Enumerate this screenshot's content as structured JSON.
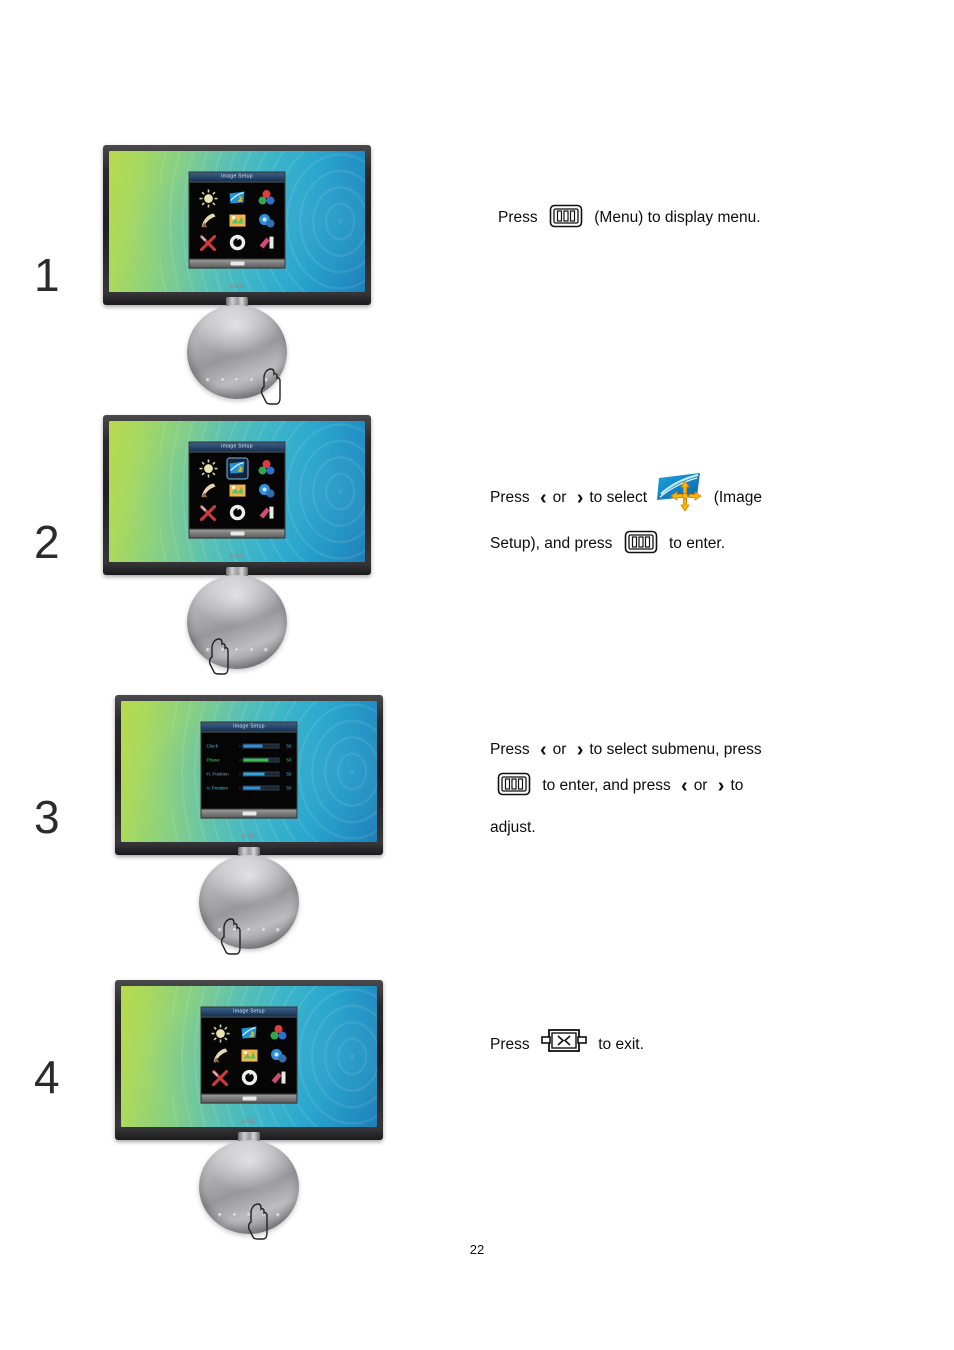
{
  "page": {
    "number": "22"
  },
  "icons": {
    "menu_key": "menu-key-icon",
    "exit_key": "exit-key-icon",
    "left_chevron": "‹",
    "right_chevron": "›",
    "image_setup": "image-setup-icon"
  },
  "steps": [
    {
      "number": "1",
      "monitor": {
        "brand": "AOC",
        "osd_title": "Image Setup",
        "osd_mode": "grid",
        "selected_index": -1
      },
      "text": {
        "lines": [
          [
            {
              "type": "text",
              "value": "Press"
            },
            {
              "type": "icon",
              "value": "menu-key-icon"
            },
            {
              "type": "text",
              "value": "(Menu) to display menu."
            }
          ]
        ]
      }
    },
    {
      "number": "2",
      "monitor": {
        "brand": "AOC",
        "osd_title": "Image Setup",
        "osd_mode": "grid",
        "selected_index": 1
      },
      "text": {
        "lines": [
          [
            {
              "type": "text",
              "value": "Press"
            },
            {
              "type": "chev",
              "value": "‹"
            },
            {
              "type": "text",
              "value": "or"
            },
            {
              "type": "chev",
              "value": "›"
            },
            {
              "type": "text",
              "value": "to select"
            },
            {
              "type": "icon",
              "value": "image-setup-icon"
            },
            {
              "type": "text",
              "value": "(Image"
            }
          ],
          [
            {
              "type": "text",
              "value": "Setup), and press"
            },
            {
              "type": "icon",
              "value": "menu-key-icon"
            },
            {
              "type": "text",
              "value": "to enter."
            }
          ]
        ]
      }
    },
    {
      "number": "3",
      "monitor": {
        "brand": "AOC",
        "osd_title": "Image Setup",
        "osd_mode": "submenu",
        "selected_index": 1,
        "submenu_rows": [
          {
            "label": "Clock",
            "value": "50",
            "fill": 55,
            "color": "#2f8fd8",
            "selected": false
          },
          {
            "label": "Phase",
            "value": "50",
            "fill": 72,
            "color": "#3fbd4a",
            "selected": true
          },
          {
            "label": "H. Position",
            "value": "50",
            "fill": 60,
            "color": "#2fa7d8",
            "selected": false
          },
          {
            "label": "V. Position",
            "value": "50",
            "fill": 48,
            "color": "#2f8fd8",
            "selected": false
          }
        ]
      },
      "text": {
        "lines": [
          [
            {
              "type": "text",
              "value": "Press"
            },
            {
              "type": "chev",
              "value": "‹"
            },
            {
              "type": "text",
              "value": "or"
            },
            {
              "type": "chev",
              "value": "›"
            },
            {
              "type": "text",
              "value": "to select submenu, press"
            }
          ],
          [
            {
              "type": "icon",
              "value": "menu-key-icon"
            },
            {
              "type": "text",
              "value": "to enter, and press"
            },
            {
              "type": "chev",
              "value": "‹"
            },
            {
              "type": "text",
              "value": "or"
            },
            {
              "type": "chev",
              "value": "›"
            },
            {
              "type": "text",
              "value": "to"
            }
          ],
          [
            {
              "type": "text",
              "value": "adjust."
            }
          ]
        ]
      }
    },
    {
      "number": "4",
      "monitor": {
        "brand": "AOC",
        "osd_title": "Image Setup",
        "osd_mode": "grid",
        "selected_index": -1
      },
      "text": {
        "lines": [
          [
            {
              "type": "text",
              "value": "Press"
            },
            {
              "type": "icon",
              "value": "exit-key-icon"
            },
            {
              "type": "text",
              "value": "to exit."
            }
          ]
        ]
      }
    }
  ],
  "osd_menu_icons": [
    "luminance-icon",
    "image-setup-icon",
    "color-setup-icon",
    "picture-boost-icon",
    "osd-setup-icon",
    "pip-setting-icon",
    "extra-icon",
    "reset-icon",
    "exit-icon"
  ],
  "colors": {
    "accent_blue": "#1e8fc4",
    "accent_green": "#b9d94f",
    "highlight_green": "#3fbd4a",
    "icon_yellow": "#f5a800",
    "bezel": "#202022"
  }
}
